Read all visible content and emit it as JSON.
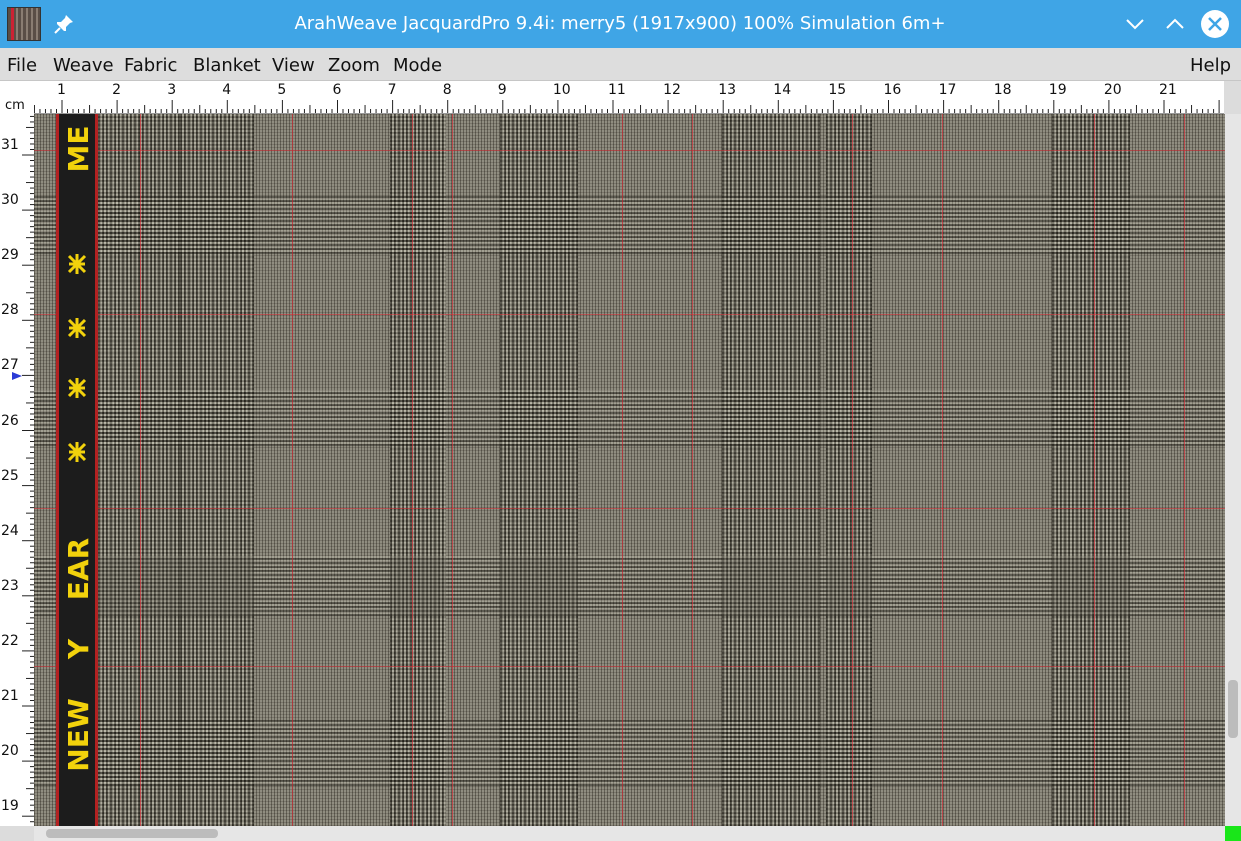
{
  "window": {
    "title": "ArahWeave JacquardPro 9.4i: merry5 (1917x900) 100% Simulation 6m+",
    "icons": [
      "app-icon",
      "pin-icon",
      "chevron-down-icon",
      "chevron-up-icon",
      "close-icon"
    ]
  },
  "menu": {
    "file": "File",
    "weave": "Weave",
    "fabric": "Fabric",
    "blanket": "Blanket",
    "view": "View",
    "zoom": "Zoom",
    "mode": "Mode",
    "help": "Help"
  },
  "ruler": {
    "unit": "cm",
    "top_labels": [
      "1",
      "2",
      "3",
      "4",
      "5",
      "6",
      "7",
      "8",
      "9",
      "10",
      "11",
      "12",
      "13",
      "14",
      "15",
      "16",
      "17",
      "18",
      "19",
      "20",
      "21"
    ],
    "left_labels": [
      "31",
      "30",
      "29",
      "28",
      "27",
      "26",
      "25",
      "24",
      "23",
      "22",
      "21",
      "20",
      "19"
    ]
  },
  "selvedge": {
    "text_top": "ME",
    "text_mid": "EAR",
    "text_year": "Y",
    "text_new": "NEW",
    "color_text": "#f2d20c",
    "color_bg": "#1c1c1c",
    "color_border": "#b32222"
  },
  "colors": {
    "titlebar": "#3fa5e6",
    "fabric_base": "#7b786c",
    "status_corner": "#19e619"
  }
}
